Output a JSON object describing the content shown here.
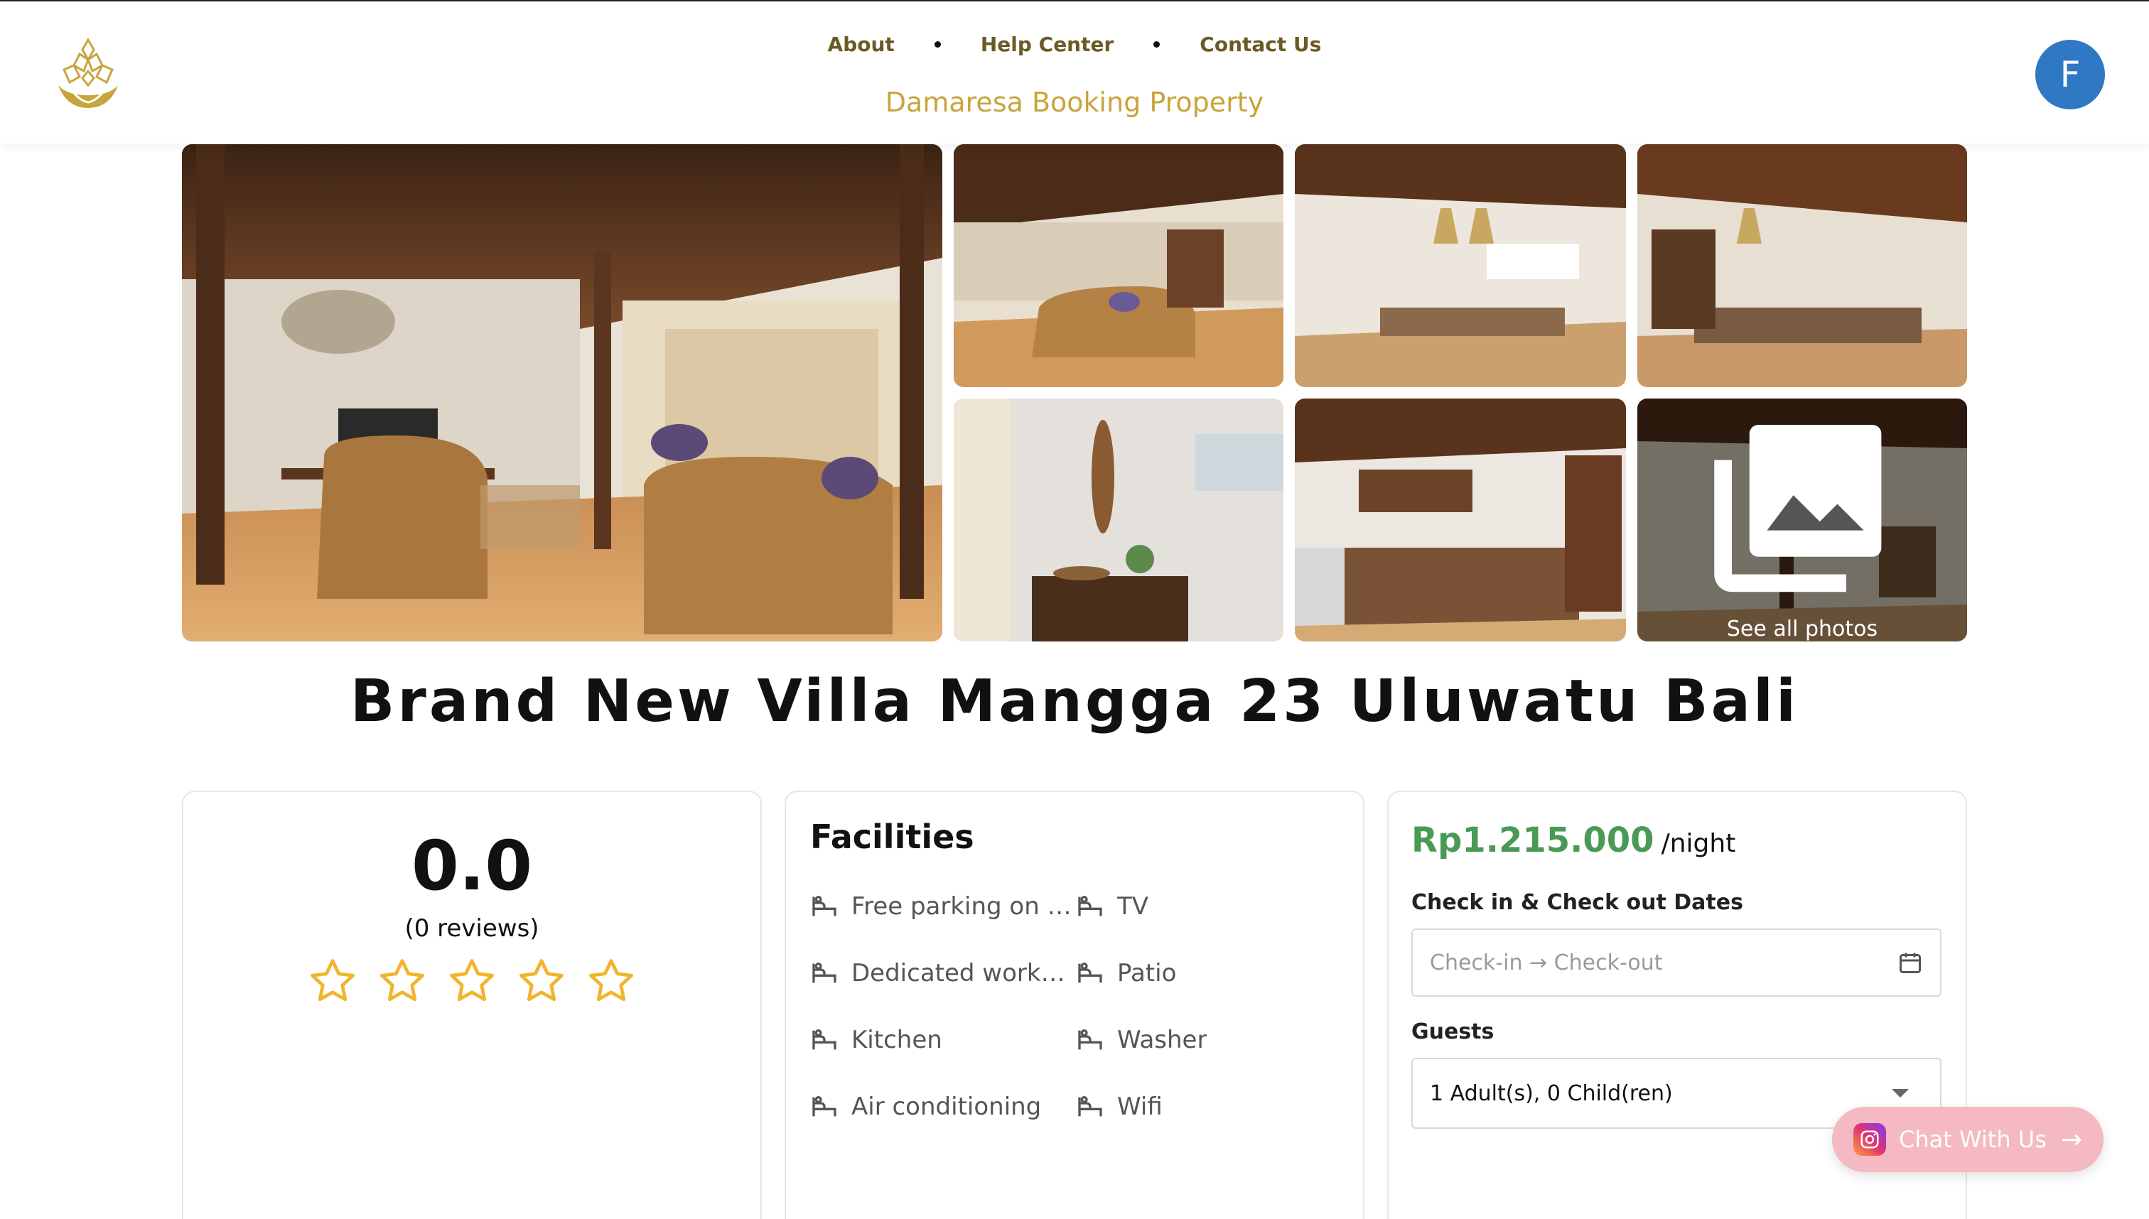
{
  "header": {
    "nav": [
      "About",
      "Help Center",
      "Contact Us"
    ],
    "brand": "Damaresa Booking Property",
    "avatar_initial": "F"
  },
  "gallery": {
    "see_all_label": "See all photos"
  },
  "listing": {
    "title": "Brand New Villa Mangga 23 Uluwatu Bali"
  },
  "rating": {
    "score": "0.0",
    "reviews": "(0 reviews)",
    "stars_filled": 0,
    "stars_total": 5
  },
  "facilities": {
    "heading": "Facilities",
    "items": [
      "Free parking on premises",
      "TV",
      "Dedicated workspace",
      "Patio",
      "Kitchen",
      "Washer",
      "Air conditioning",
      "Wifi"
    ]
  },
  "booking": {
    "price": "Rp1.215.000",
    "per_night": "/night",
    "dates_label": "Check in & Check out Dates",
    "dates_placeholder": "Check-in → Check-out",
    "guests_label": "Guests",
    "guests_value": "1 Adult(s), 0 Child(ren)"
  },
  "chat": {
    "label": "Chat With Us"
  },
  "colors": {
    "brand_gold": "#c9a43c",
    "nav_text": "#6b5a24",
    "price_green": "#4a9a55",
    "avatar_blue": "#2f78c4",
    "star_gold": "#f0b52d",
    "chat_pink": "#f4b9c2"
  }
}
